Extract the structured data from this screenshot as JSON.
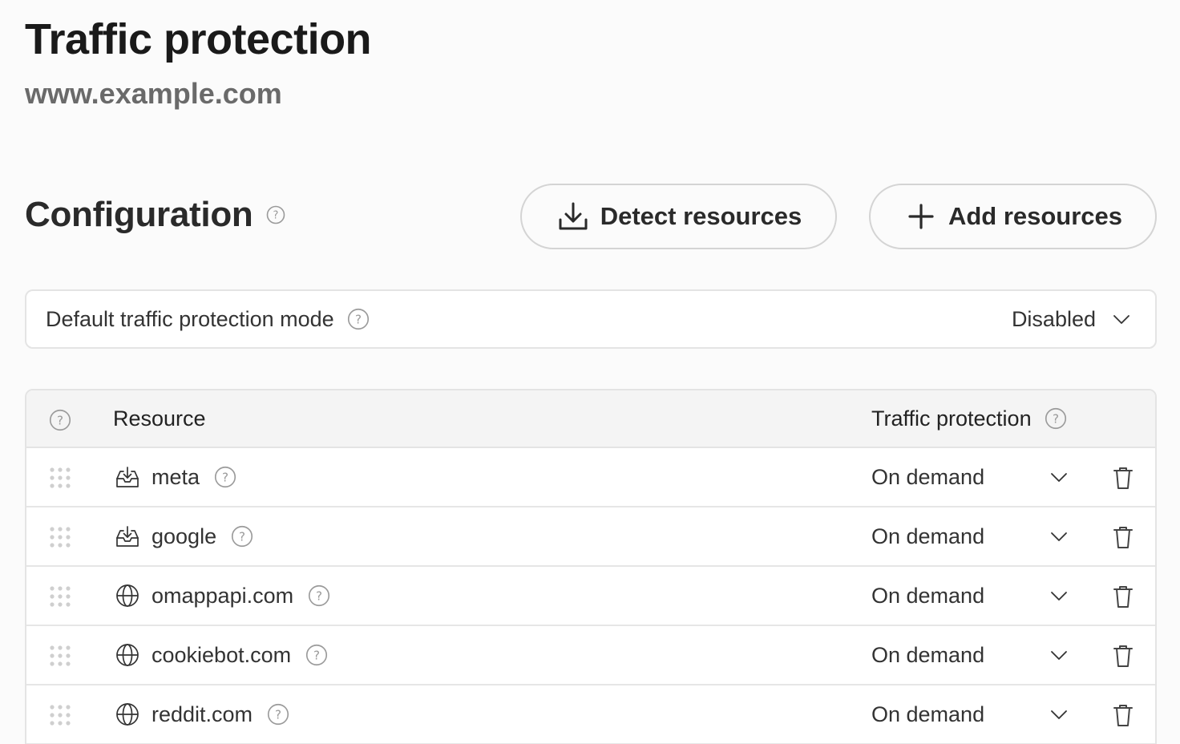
{
  "header": {
    "title": "Traffic protection",
    "domain": "www.example.com"
  },
  "configuration": {
    "title": "Configuration",
    "detect_label": "Detect resources",
    "add_label": "Add resources"
  },
  "default_mode": {
    "label": "Default traffic protection mode",
    "value": "Disabled"
  },
  "table": {
    "col_resource": "Resource",
    "col_protection": "Traffic protection",
    "rows": [
      {
        "name": "meta",
        "icon": "inbox-download-icon",
        "mode": "On demand"
      },
      {
        "name": "google",
        "icon": "inbox-download-icon",
        "mode": "On demand"
      },
      {
        "name": "omappapi.com",
        "icon": "globe-icon",
        "mode": "On demand"
      },
      {
        "name": "cookiebot.com",
        "icon": "globe-icon",
        "mode": "On demand"
      },
      {
        "name": "reddit.com",
        "icon": "globe-icon",
        "mode": "On demand"
      }
    ]
  }
}
